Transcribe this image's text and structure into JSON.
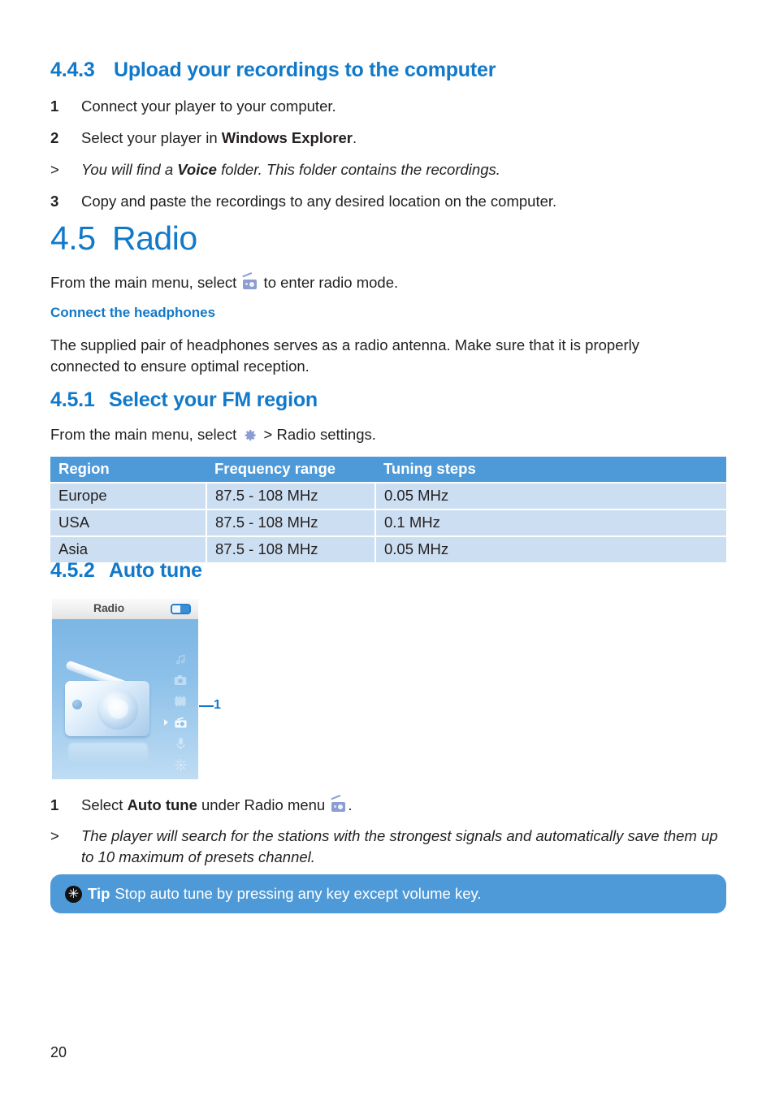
{
  "section_443": {
    "number": "4.4.3",
    "title": "Upload your recordings to the computer",
    "steps": [
      {
        "marker": "1",
        "text_before": "Connect your player to your computer.",
        "bold": "",
        "text_after": "",
        "italic": false
      },
      {
        "marker": "2",
        "text_before": "Select your player in ",
        "bold": "Windows Explorer",
        "text_after": ".",
        "italic": false
      },
      {
        "marker": ">",
        "text_before": "You will find a ",
        "bold": "Voice",
        "text_after": " folder. This folder contains the recordings.",
        "italic": true
      },
      {
        "marker": "3",
        "text_before": "Copy and paste the recordings to any desired location on the computer.",
        "bold": "",
        "text_after": "",
        "italic": false
      }
    ]
  },
  "section_45": {
    "number": "4.5",
    "title": "Radio",
    "intro_before": "From the main menu, select ",
    "intro_after": " to enter radio mode.",
    "intro_icon": "radio-icon",
    "subhead": "Connect the headphones",
    "body": "The supplied pair of headphones serves as a radio antenna. Make sure that it is properly connected to ensure optimal reception."
  },
  "section_451": {
    "number": "4.5.1",
    "title": "Select your FM region",
    "intro_before": "From the main menu, select ",
    "intro_after": " > Radio settings.",
    "intro_icon": "gear-icon",
    "table": {
      "columns": [
        "Region",
        "Frequency range",
        "Tuning steps"
      ],
      "rows": [
        [
          "Europe",
          "87.5 - 108 MHz",
          "0.05 MHz"
        ],
        [
          "USA",
          "87.5 - 108 MHz",
          "0.1 MHz"
        ],
        [
          "Asia",
          "87.5 - 108 MHz",
          "0.05 MHz"
        ]
      ]
    }
  },
  "section_452": {
    "number": "4.5.2",
    "title": "Auto tune",
    "device": {
      "title": "Radio",
      "battery_icon": "battery-icon",
      "rail_icons": [
        "music-note-icon",
        "camera-icon",
        "video-icon",
        "radio-icon",
        "microphone-icon",
        "gear-icon"
      ],
      "active_rail_index": 3,
      "callout_number": "1"
    },
    "steps": [
      {
        "marker": "1",
        "text_before": "Select ",
        "bold": "Auto tune",
        "text_after": " under Radio menu ",
        "suffix": ".",
        "italic": false,
        "has_icon": true
      },
      {
        "marker": ">",
        "text_before": "The player will search for the stations with the strongest signals and automatically save them up to 10 maximum of presets channel.",
        "bold": "",
        "text_after": "",
        "italic": true
      }
    ]
  },
  "tip": {
    "icon": "asterisk-icon",
    "label": "Tip",
    "text": "Stop auto tune by pressing any key except volume key."
  },
  "footer": {
    "page_number": "20"
  },
  "colors": {
    "heading_blue": "#1179c9",
    "table_header_blue": "#4e9ad8",
    "table_row_blue": "#ccdff2",
    "tip_blue": "#4e9ad8",
    "body_text": "#231f20"
  }
}
